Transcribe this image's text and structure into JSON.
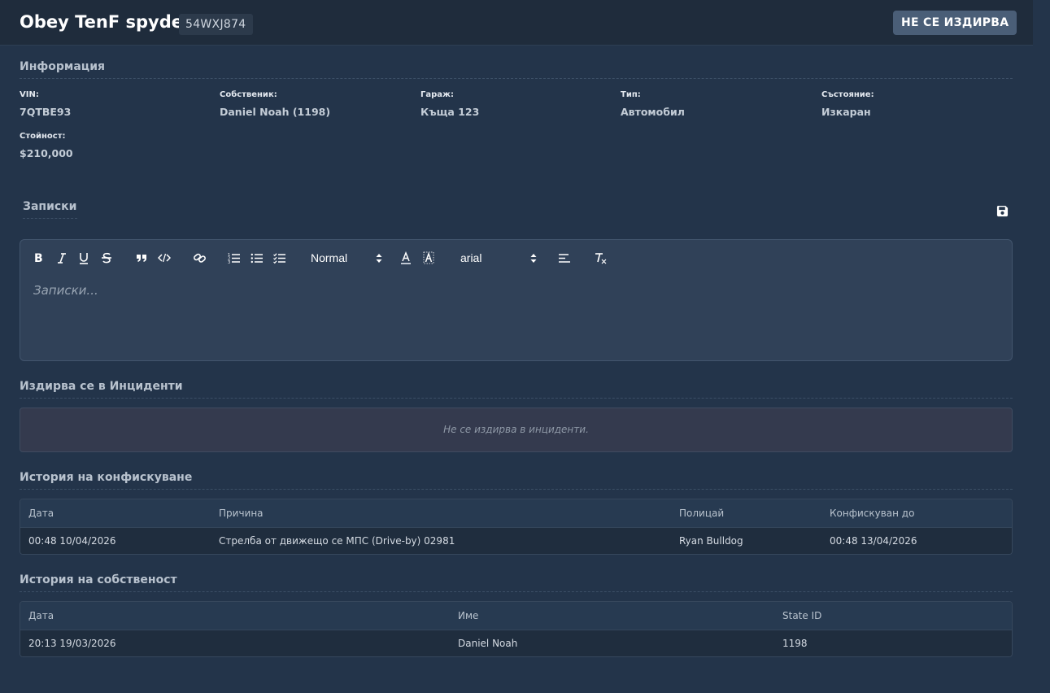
{
  "header": {
    "vehicle_name": "Obey TenF spyder",
    "plate": "54WXJ874",
    "wanted_button": "НЕ СЕ ИЗДИРВА"
  },
  "info": {
    "title": "Информация",
    "fields": [
      {
        "label": "VIN:",
        "value": "7QTBE93"
      },
      {
        "label": "Собственик:",
        "value": "Daniel Noah (1198)"
      },
      {
        "label": "Гараж:",
        "value": "Къща 123"
      },
      {
        "label": "Тип:",
        "value": "Автомобил"
      },
      {
        "label": "Състояние:",
        "value": "Изкаран"
      },
      {
        "label": "Стойност:",
        "value": "$210,000"
      }
    ]
  },
  "notes": {
    "title": "Записки",
    "placeholder": "Записки...",
    "toolbar": {
      "size_select": "Normal",
      "font_select": "arial"
    },
    "save_icon": "floppy-disk-icon"
  },
  "wanted_incidents": {
    "title": "Издирва се в Инциденти",
    "empty_text": "Не се издирва в инциденти."
  },
  "impound_history": {
    "title": "История на конфискуване",
    "columns": [
      "Дата",
      "Причина",
      "Полицай",
      "Конфискуван до"
    ],
    "rows": [
      [
        "00:48 10/04/2026",
        "Стрелба от движещо се МПС (Drive-by) 02981",
        "Ryan Bulldog",
        "00:48 13/04/2026"
      ]
    ]
  },
  "ownership_history": {
    "title": "История на собственост",
    "columns": [
      "Дата",
      "Име",
      "State ID"
    ],
    "rows": [
      [
        "20:13 19/03/2026",
        "Daniel Noah",
        "1198"
      ]
    ]
  }
}
